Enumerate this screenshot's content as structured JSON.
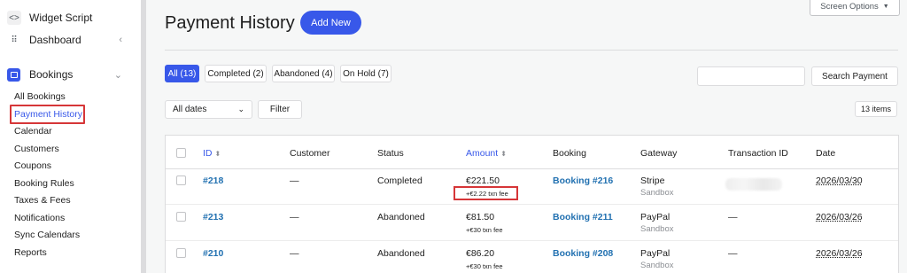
{
  "sidebar": {
    "widget_script": "Widget Script",
    "dashboard": "Dashboard",
    "bookings": "Bookings",
    "items": [
      "All Bookings",
      "Payment History",
      "Calendar",
      "Customers",
      "Coupons",
      "Booking Rules",
      "Taxes & Fees",
      "Notifications",
      "Sync Calendars",
      "Reports"
    ],
    "active_item": "Payment History"
  },
  "header": {
    "title": "Payment History",
    "add_new": "Add New",
    "screen_options": "Screen Options"
  },
  "tabs": [
    "All (13)",
    "Completed (2)",
    "Abandoned (4)",
    "On Hold (7)"
  ],
  "search": {
    "button": "Search Payment",
    "placeholder": ""
  },
  "filters": {
    "dates": "All dates",
    "filter_button": "Filter",
    "items_count": "13 items"
  },
  "table": {
    "columns": [
      "ID",
      "Customer",
      "Status",
      "Amount",
      "Booking",
      "Gateway",
      "Transaction ID",
      "Date"
    ],
    "rows": [
      {
        "id": "#218",
        "customer": "—",
        "status": "Completed",
        "amount": "€221.50",
        "fee": "+€2.22 txn fee",
        "booking": "Booking #216",
        "gateway": "Stripe",
        "gateway_mode": "Sandbox",
        "transaction": "",
        "date": "2026/03/30"
      },
      {
        "id": "#213",
        "customer": "—",
        "status": "Abandoned",
        "amount": "€81.50",
        "fee": "+€30 txn fee",
        "booking": "Booking #211",
        "gateway": "PayPal",
        "gateway_mode": "Sandbox",
        "transaction": "—",
        "date": "2026/03/26"
      },
      {
        "id": "#210",
        "customer": "—",
        "status": "Abandoned",
        "amount": "€86.20",
        "fee": "+€30 txn fee",
        "booking": "Booking #208",
        "gateway": "PayPal",
        "gateway_mode": "Sandbox",
        "transaction": "—",
        "date": "2026/03/26"
      }
    ]
  },
  "colors": {
    "accent": "#3858e9",
    "link": "#2271b1",
    "highlight": "#d63638"
  },
  "icons": {
    "widget": "code-icon",
    "dashboard": "grid-icon",
    "bookings": "calendar-icon"
  }
}
